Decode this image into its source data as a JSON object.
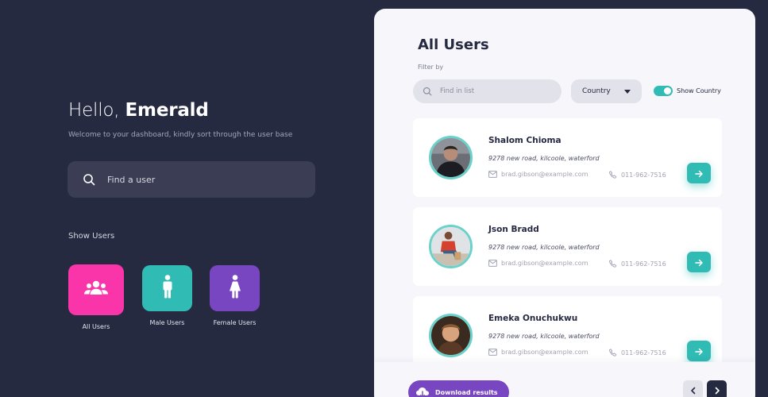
{
  "greeting": {
    "hello": "Hello,",
    "name": "Emerald"
  },
  "welcome_text": "Welcome to your dashboard, kindly sort through the user base",
  "main_search": {
    "placeholder": "Find a user"
  },
  "show_users": {
    "heading": "Show Users",
    "tiles": [
      {
        "label": "All Users",
        "color": "#f935a9",
        "icon": "users-group-icon"
      },
      {
        "label": "Male Users",
        "color": "#30bbb5",
        "icon": "male-icon"
      },
      {
        "label": "Female Users",
        "color": "#7946c1",
        "icon": "female-icon"
      }
    ]
  },
  "panel": {
    "title": "All Users",
    "filter_label": "Filter by",
    "find_placeholder": "Find in list",
    "country_label": "Country",
    "show_country_label": "Show Country",
    "show_country_on": true
  },
  "users": [
    {
      "name": "Shalom Chioma",
      "address": "9278 new road, kilcoole, waterford",
      "email": "brad.gibson@example.com",
      "phone": "011-962-7516"
    },
    {
      "name": "Json Bradd",
      "address": "9278 new road, kilcoole, waterford",
      "email": "brad.gibson@example.com",
      "phone": "011-962-7516"
    },
    {
      "name": "Emeka Onuchukwu",
      "address": "9278 new road, kilcoole, waterford",
      "email": "brad.gibson@example.com",
      "phone": "011-962-7516"
    }
  ],
  "footer": {
    "download_label": "Download results"
  },
  "colors": {
    "background": "#262a41",
    "teal": "#30bbb5",
    "pink": "#f935a9",
    "purple": "#7946c1",
    "panel": "#f6f6fb"
  }
}
